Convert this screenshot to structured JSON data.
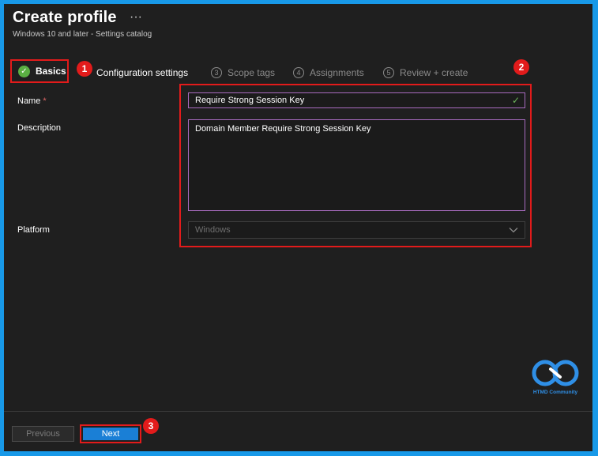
{
  "header": {
    "title": "Create profile",
    "more": "···",
    "subtitle": "Windows 10 and later - Settings catalog"
  },
  "steps": {
    "basics": "Basics",
    "configuration": "Configuration settings",
    "scope": {
      "num": "3",
      "label": "Scope tags"
    },
    "assignments": {
      "num": "4",
      "label": "Assignments"
    },
    "review": {
      "num": "5",
      "label": "Review + create"
    }
  },
  "annotations": {
    "one": "1",
    "two": "2",
    "three": "3"
  },
  "form": {
    "name_label": "Name",
    "required_mark": "*",
    "name_value": "Require Strong Session Key",
    "description_label": "Description",
    "description_value": "Domain Member Require Strong Session Key",
    "platform_label": "Platform",
    "platform_value": "Windows"
  },
  "logo": {
    "text": "HTMD Community"
  },
  "footer": {
    "previous": "Previous",
    "next": "Next"
  },
  "colors": {
    "frame_border": "#1899e8",
    "background": "#1f1f1f",
    "annotation_red": "#e21b1b",
    "success_green": "#5bb043",
    "input_focus_border": "#a86bbf",
    "primary_button": "#1a7fd6"
  }
}
